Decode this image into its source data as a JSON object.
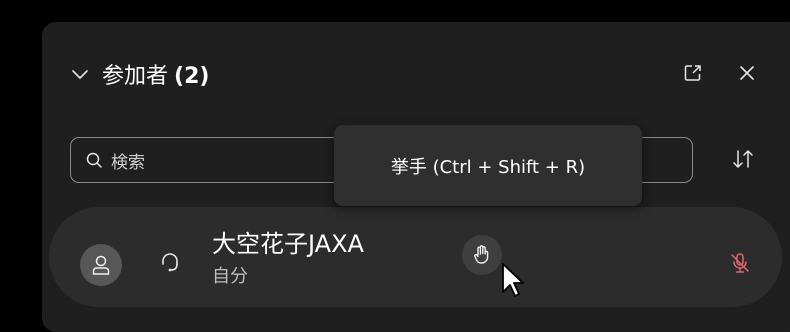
{
  "header": {
    "title": "参加者",
    "count": "(2)"
  },
  "search": {
    "placeholder": "検索"
  },
  "tooltip": {
    "text": "挙手 (Ctrl + Shift + R)"
  },
  "participants": [
    {
      "name": "大空花子JAXA",
      "subtitle": "自分"
    }
  ],
  "icons": {
    "collapse": "chevron-down-icon",
    "popout": "popout-icon",
    "close": "close-icon",
    "search": "search-icon",
    "sort": "sort-icon",
    "avatar": "person-icon",
    "audio": "headset-icon",
    "raise_hand": "raise-hand-icon",
    "mic": "mic-muted-icon"
  },
  "colors": {
    "background": "#000000",
    "panel": "#1f1f1f",
    "row": "#2c2c2c",
    "tooltip": "#2f2f2f",
    "muted_mic": "#e0666f"
  }
}
